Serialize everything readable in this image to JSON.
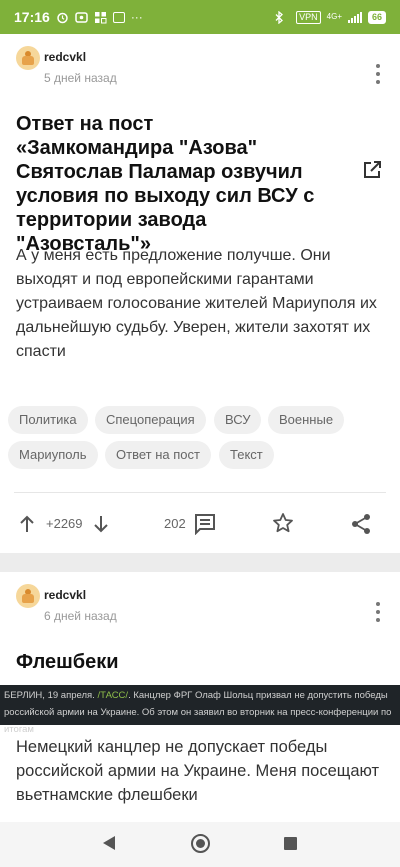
{
  "status_bar": {
    "time": "17:16",
    "icons_left": [
      "alarm-icon",
      "app-icon",
      "app-icon",
      "app-icon",
      "more-icon"
    ],
    "vpn": "VPN",
    "network": "4G+",
    "battery": "66",
    "color": "#7fb13a"
  },
  "post1": {
    "author": "redcvkl",
    "date": "5 дней назад",
    "title": "Ответ на пост «Замкомандира \"Азова\" Святослав Паламар озвучил условия по выходу сил ВСУ с территории завода \"Азовсталь\"»",
    "body": "А у меня есть предложение получше. Они выходят и под европейскими гарантами устраиваем голосование жителей Мариуполя их дальнейшую судьбу. Уверен, жители захотят их спасти",
    "tags": [
      "Политика",
      "Спецоперация",
      "ВСУ",
      "Военные",
      "Мариуполь",
      "Ответ на пост",
      "Текст"
    ],
    "rating": "+2269",
    "comments": "202"
  },
  "post2": {
    "author": "redcvkl",
    "date": "6 дней назад",
    "title": "Флешбеки",
    "image_text_prefix": "БЕРЛИН, 19 апреля. ",
    "image_text_source": "/ТАСС/",
    "image_text_rest": ". Канцлер ФРГ Олаф Шольц призвал не допустить победы российской армии на Украине. Об этом он заявил во вторник на пресс-конференции по итогам",
    "body": "Немецкий канцлер не допускает победы российской армии на Украине. Меня посещают вьетнамские флешбеки"
  },
  "colors": {
    "accent": "#7fb13a",
    "icon": "#555555"
  }
}
